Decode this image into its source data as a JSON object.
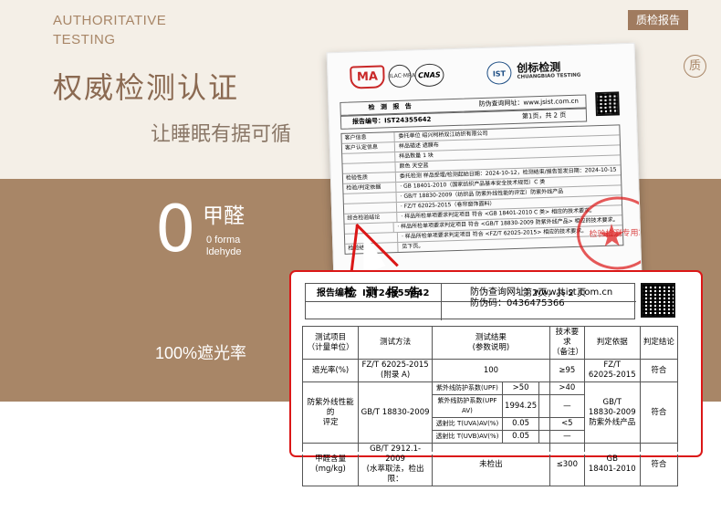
{
  "header": {
    "english_title": [
      "AUTHORITATIVE",
      "TESTING"
    ],
    "tag": "质检报告",
    "circle_icon": "质",
    "heading": "权威检测认证",
    "subheading": "让睡眠有据可循"
  },
  "features": {
    "formaldehyde_value": "0",
    "formaldehyde_label": "甲醛",
    "formaldehyde_en": [
      "0 forma",
      "ldehyde"
    ],
    "shading": "100%遮光率"
  },
  "paper": {
    "logos": {
      "ma": "MA",
      "ilac": "ILAC·MRA",
      "cnas": "CNAS",
      "ist": "IST"
    },
    "brand_cn": "创标检测",
    "brand_en": "CHUANGBIAO TESTING",
    "small_title": "检 测 报 告",
    "small_query": "防伪查询网址：www.jsist.com.cn",
    "small_code": "防伪码：0436475366",
    "small_report_no": "报告编号：IST24355642",
    "small_page": "第1页，共 2 页",
    "rows": [
      {
        "k": "客户信息",
        "v": "委托单位    绍兴柯桥双江纺织有限公司"
      },
      {
        "k": "客户认定信息",
        "v": "样品描述    遮膜布"
      },
      {
        "k": "",
        "v": "样品数量    1 块"
      },
      {
        "k": "",
        "v": "颜色        天空蓝"
      },
      {
        "k": "检验性质",
        "v": "委托检测    样品受理/检测起始日期：2024-10-12，检测结束/报告签发日期：2024-10-15"
      },
      {
        "k": "检验/判定依据",
        "v": "· GB 18401-2010（国家纺织产品基本安全技术规范）C 类"
      },
      {
        "k": "",
        "v": "· GB/T 18830-2009（纺织品 防紫外线性能的评定）防紫外线产品"
      },
      {
        "k": "",
        "v": "· FZ/T 62025-2015（卷帘窗饰面料）"
      },
      {
        "k": "综合检验结论",
        "v": "· 样品所检单项要求判定项目 符合 <GB 18401-2010 C 类> 相应的技术要求。"
      },
      {
        "k": "",
        "v": "· 样品所检单项要求判定项目 符合 <GB/T 18830-2009 防紫外线产品> 相应的技术要求。"
      },
      {
        "k": "",
        "v": "· 样品所检单项要求判定项目 符合 <FZ/T 62025-2015> 相应的技术要求。"
      },
      {
        "k": "检验结论",
        "v": "见下页。"
      }
    ],
    "stamp": "检验检测专用章"
  },
  "report": {
    "title": "检 测 报 告",
    "query_site": "防伪查询网址：www.jsist.com.cn",
    "code": "防伪码：0436475366",
    "report_no": "报告编号：IST24355642",
    "page": "第2页，共 2 页"
  },
  "table": {
    "headers": [
      "测试项目\n（计量单位）",
      "测试方法",
      "测试结果\n(参数说明)",
      "技术要求\n（备注）",
      "判定依据",
      "判定结论"
    ],
    "rows": [
      {
        "item": "遮光率(%)",
        "method": "FZ/T 62025-2015\n(附录 A)",
        "result": "100",
        "req": "≥95",
        "basis": "FZ/T\n62025-2015",
        "conclusion": "符合"
      },
      {
        "item": "防紫外线性能的\n评定",
        "method": "GB/T 18830-2009",
        "uv1": "紫外线防护系数(UPF)",
        "uv1v": ">50",
        "uv1r": ">40",
        "uv2": "紫外线防护系数(UPF AV)",
        "uv2v": "1994.25",
        "uv2r": "—",
        "uv3": "透射比 T(UVA)AV(%)",
        "uv3v": "0.05",
        "uv3r": "<5",
        "uv4": "透射比 T(UVB)AV(%)",
        "uv4v": "0.05",
        "uv4r": "—",
        "basis": "GB/T\n18830-2009\n防紫外线产品",
        "conclusion": "符合"
      },
      {
        "item": "甲醛含量\n(mg/kg)",
        "method": "GB/T 2912.1-2009\n(水萃取法，检出限：",
        "result": "未检出",
        "req": "≤300",
        "basis": "GB\n18401-2010",
        "conclusion": "符合"
      }
    ]
  },
  "colors": {
    "beige": "#f4efe7",
    "brown": "#a88667",
    "red": "#db1717"
  }
}
